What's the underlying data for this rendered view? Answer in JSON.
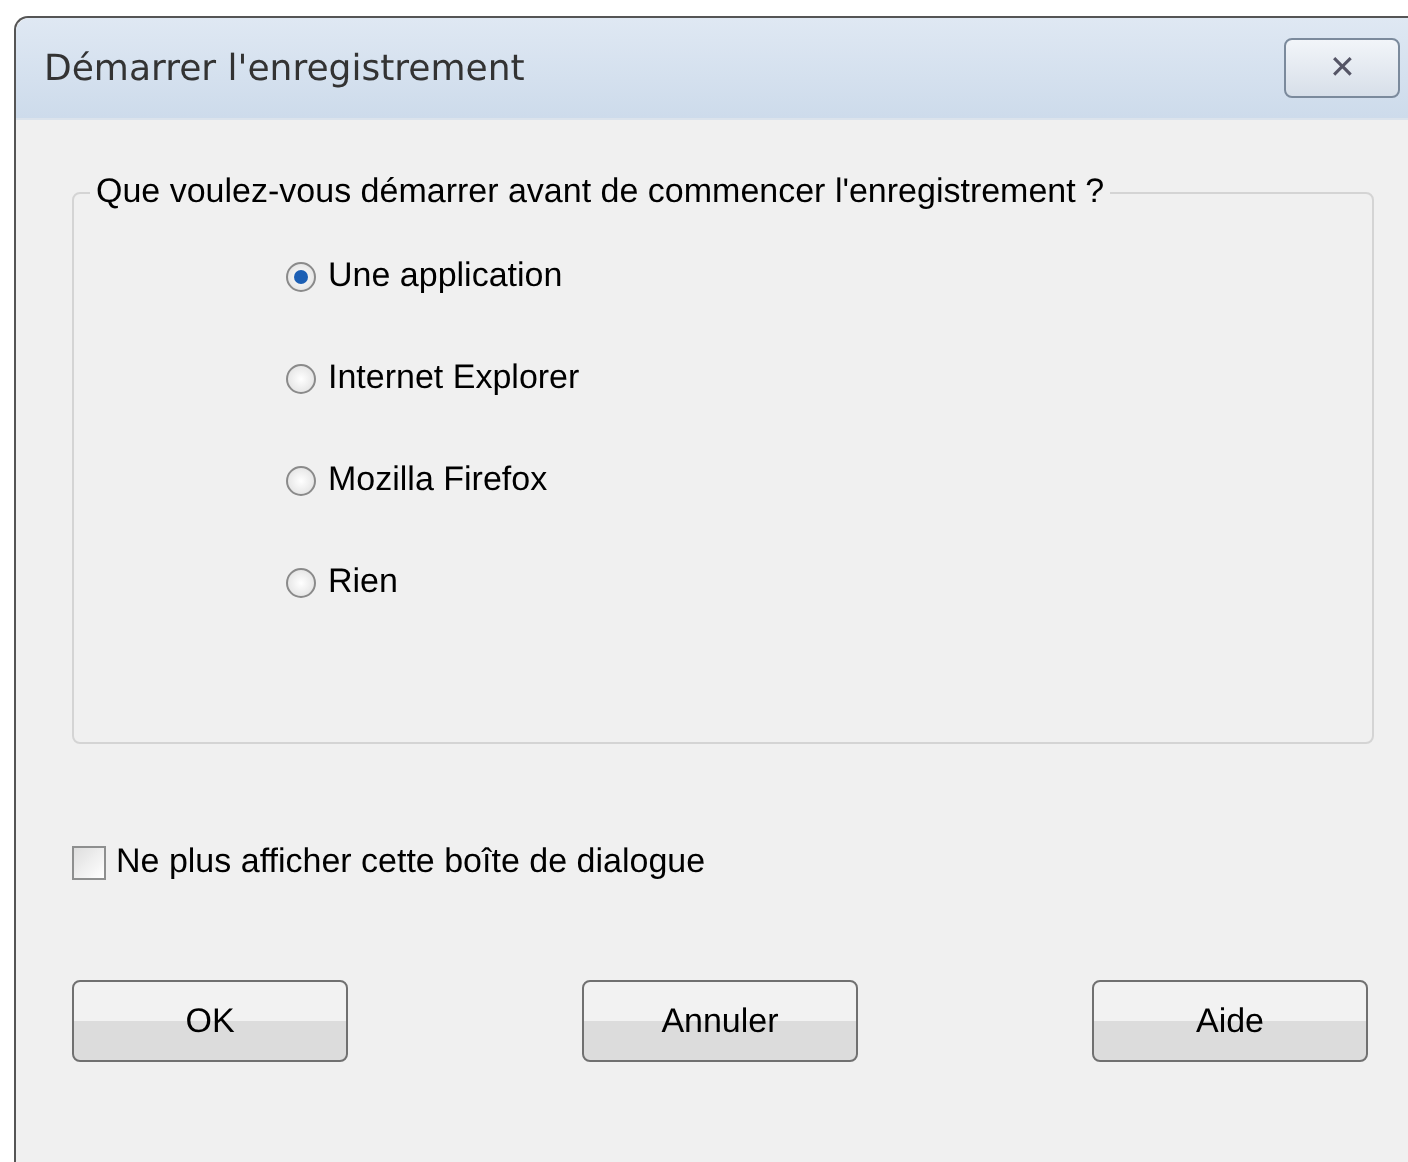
{
  "window": {
    "title": "Démarrer l'enregistrement",
    "close": "✕"
  },
  "group": {
    "legend": "Que voulez-vous démarrer avant de commencer l'enregistrement ?",
    "options": [
      {
        "label": "Une application",
        "selected": true
      },
      {
        "label": "Internet Explorer",
        "selected": false
      },
      {
        "label": "Mozilla Firefox",
        "selected": false
      },
      {
        "label": "Rien",
        "selected": false
      }
    ]
  },
  "checkbox": {
    "label": "Ne plus afficher cette boîte de dialogue",
    "checked": false
  },
  "buttons": [
    "OK",
    "Annuler",
    "Aide"
  ]
}
